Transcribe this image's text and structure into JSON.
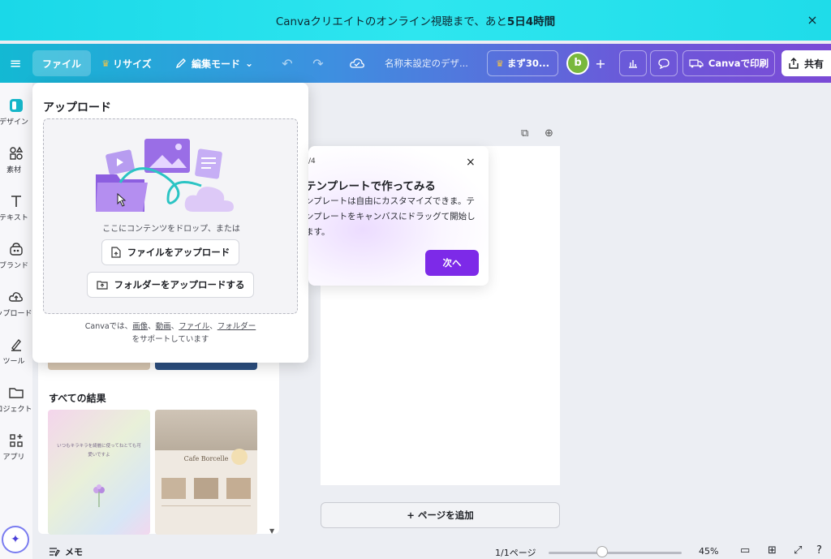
{
  "banner": {
    "text_prefix": "Canvaクリエイトのオンライン視聴まで、あと",
    "text_bold": "5日4時間",
    "close": "×"
  },
  "toolbar": {
    "file": "ファイル",
    "resize": "リサイズ",
    "edit_mode": "編集モード",
    "title": "名称未設定のデザ...",
    "trial": "まず30...",
    "avatar_letter": "b",
    "print": "Canvaで印刷",
    "share": "共有"
  },
  "rail": {
    "items": [
      {
        "label": "デザイン",
        "icon": "design-icon"
      },
      {
        "label": "素材",
        "icon": "elements-icon"
      },
      {
        "label": "テキスト",
        "icon": "text-icon"
      },
      {
        "label": "ブランド",
        "icon": "brand-icon"
      },
      {
        "label": "ップロード",
        "icon": "upload-icon"
      },
      {
        "label": "ツール",
        "icon": "tools-icon"
      },
      {
        "label": "ロジェクト",
        "icon": "projects-icon"
      },
      {
        "label": "アプリ",
        "icon": "apps-icon"
      }
    ]
  },
  "upload": {
    "title": "アップロード",
    "drop_hint": "ここにコンテンツをドロップ、または",
    "upload_file": "ファイルをアップロード",
    "upload_folder": "フォルダーをアップロードする",
    "support_prefix": "Canvaでは、",
    "support_image": "画像",
    "support_video": "動画",
    "support_file": "ファイル",
    "support_folder": "フォルダー",
    "support_suffix": "をサポートしています",
    "sep": "、"
  },
  "panel": {
    "results_title": "すべての結果",
    "card1_text": "いつもキラキラを綺麗に使ってねとても可愛いですよ",
    "card2_title": "Cafe Borcelle"
  },
  "tip": {
    "step": "/4",
    "title": "テンプレートで作ってみる",
    "body": "ンプレートは自由にカスタマイズできま。テンプレートをキャンバスにドラッグて開始します。",
    "next": "次へ",
    "close": "×"
  },
  "canvas": {
    "add_page": "+ ページを追加"
  },
  "bottom": {
    "memo": "メモ",
    "pages": "1/1ページ",
    "zoom": "45%",
    "zoom_level": 45
  }
}
